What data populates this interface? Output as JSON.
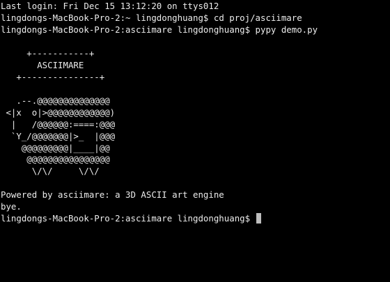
{
  "session": {
    "last_login": "Last login: Fri Dec 15 13:12:20 on ttys012"
  },
  "commands": [
    {
      "prompt": "lingdongs-MacBook-Pro-2:~ lingdonghuang$ ",
      "command": "cd proj/asciimare"
    },
    {
      "prompt": "lingdongs-MacBook-Pro-2:asciimare lingdonghuang$ ",
      "command": "pypy demo.py"
    }
  ],
  "output": {
    "banner": [
      "     +-----------+",
      "       ASCIIMARE",
      "   +---------------+"
    ],
    "art": [
      "   .--.@@@@@@@@@@@@@@",
      " <|x  o|>@@@@@@@@@@@@)",
      "  |   /@@@@@@:====:@@@",
      "  `Y_/@@@@@@@|>_  |@@@",
      "    @@@@@@@@@|____|@@",
      "     @@@@@@@@@@@@@@@@",
      "      \\/\\/     \\/\\/"
    ],
    "powered_by": "Powered by asciimare: a 3D ASCII art engine",
    "bye": "bye."
  },
  "current_prompt": "lingdongs-MacBook-Pro-2:asciimare lingdonghuang$ ",
  "colors": {
    "background": "#000000",
    "text": "#ececec",
    "cursor": "#bdbdbd"
  }
}
